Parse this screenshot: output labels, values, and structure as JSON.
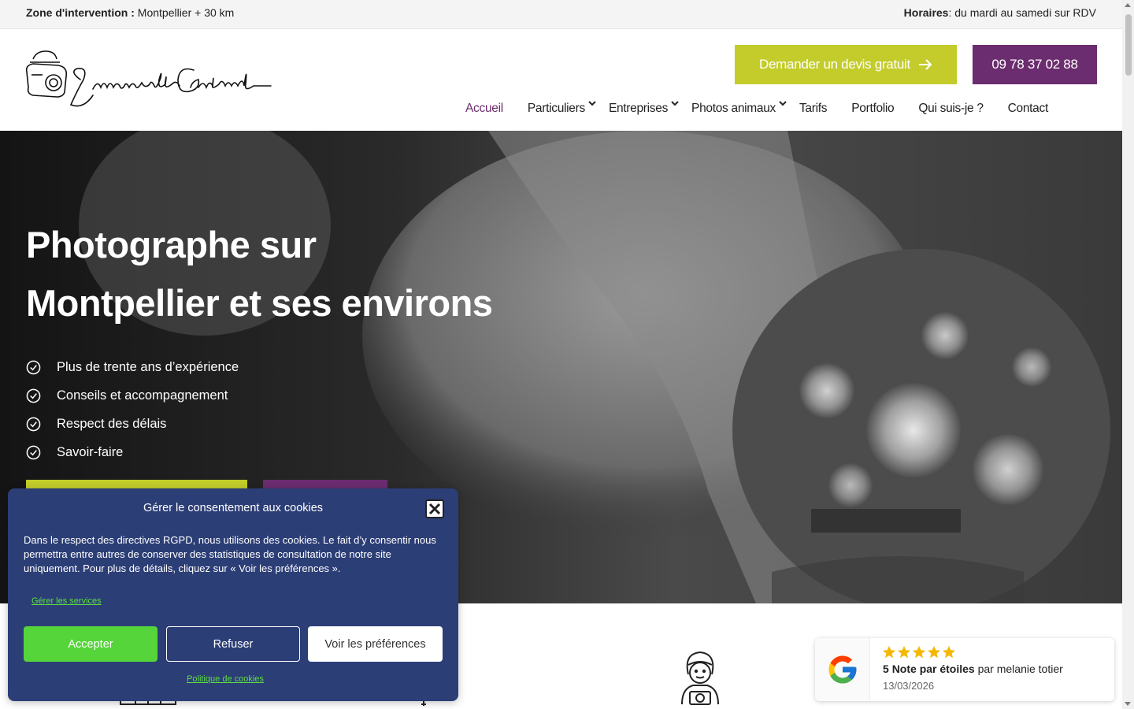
{
  "topbar": {
    "zone_label": "Zone d'intervention :",
    "zone_value": "Montpellier + 30 km",
    "hours_label": "Horaires",
    "hours_value": ": du mardi au samedi sur RDV"
  },
  "header": {
    "logo_alt": "Emmanuelle Grimaud",
    "quote_button": "Demander un devis gratuit",
    "phone_button": "09 78 37 02 88",
    "nav": [
      {
        "label": "Accueil",
        "active": true
      },
      {
        "label": "Particuliers",
        "dropdown": true
      },
      {
        "label": "Entreprises",
        "dropdown": true
      },
      {
        "label": "Photos animaux",
        "dropdown": true
      },
      {
        "label": "Tarifs"
      },
      {
        "label": "Portfolio"
      },
      {
        "label": "Qui suis-je ?"
      },
      {
        "label": "Contact"
      }
    ]
  },
  "hero": {
    "title_line1": "Photographe sur",
    "title_line2": "Montpellier et ses environs",
    "bullets": [
      "Plus de trente ans d’expérience",
      "Conseils et accompagnement",
      "Respect des délais",
      "Savoir-faire"
    ]
  },
  "cookie": {
    "title": "Gérer le consentement aux cookies",
    "text": "Dans le respect des directives RGPD, nous utilisons des cookies. Le fait d’y consentir nous permettra entre autres de conserver des statistiques de consultation de notre site uniquement. Pour plus de détails, cliquez sur « Voir les préférences ».",
    "manage_link": "Gérer les services",
    "accept": "Accepter",
    "refuse": "Refuser",
    "preferences": "Voir les préférences",
    "policy_link": "Politique de cookies"
  },
  "review": {
    "rating": 5,
    "score": "5",
    "score_label": "Note par étoiles",
    "by": "par melanie totier",
    "date": "13/03/2026"
  },
  "colors": {
    "accent_green": "#c3cc2b",
    "accent_purple": "#6b2d6f",
    "cookie_bg": "#2c3e76",
    "cookie_accept": "#56d53a",
    "star": "#f5b800"
  }
}
